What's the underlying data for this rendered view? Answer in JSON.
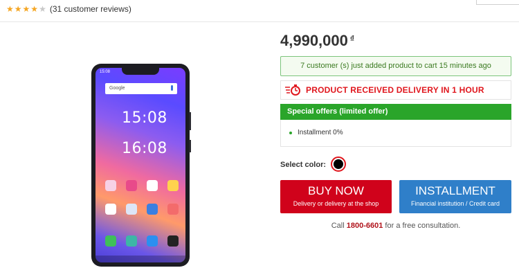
{
  "rating": {
    "stars_filled": 4,
    "stars_total": 5,
    "reviews_text": "(31 customer reviews)"
  },
  "product": {
    "price": "4,990,000",
    "currency": "₫"
  },
  "cart_note": "7 customer (s) just added product to cart 15 minutes ago",
  "delivery": {
    "text": "PRODUCT RECEIVED DELIVERY IN 1 HOUR"
  },
  "offers": {
    "title": "Special offers (limited offer)",
    "items": [
      "Installment 0%"
    ]
  },
  "color_select": {
    "label": "Select color:",
    "selected": "#000000"
  },
  "buttons": {
    "buy": {
      "title": "BUY NOW",
      "subtitle": "Delivery or delivery at the shop"
    },
    "installment": {
      "title": "INSTALLMENT",
      "subtitle": "Financial institution / Credit card"
    }
  },
  "consultation": {
    "prefix": "Call",
    "phone": "1800-6601",
    "suffix": "for a free consultation."
  },
  "phone_screen": {
    "search_label": "Google",
    "clock_1": "15:08",
    "clock_2": "16:08",
    "status_time": "15:08"
  },
  "colors": {
    "accent_red": "#d0021b",
    "offer_green": "#2aa52a",
    "installment_blue": "#2f7fc9",
    "star": "#f5a623"
  }
}
